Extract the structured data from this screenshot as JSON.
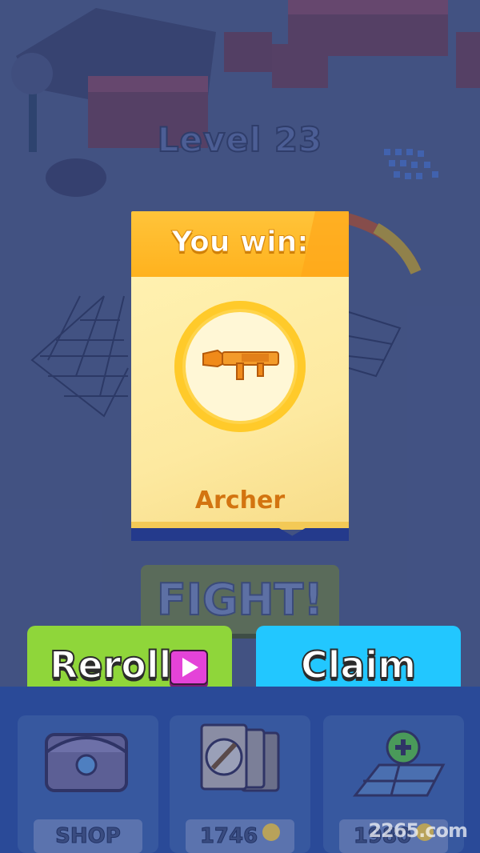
{
  "level_title": "Level 23",
  "reward_card": {
    "header": "You win:",
    "item_name": "Archer",
    "item_icon": "rocket-launcher-icon"
  },
  "fight_button": "FIGHT!",
  "reroll_button": {
    "label": "Reroll",
    "icon": "play-video-icon"
  },
  "claim_button": {
    "label": "Claim"
  },
  "bottom_bar": {
    "shop": {
      "label": "SHOP",
      "icon": "chest-icon"
    },
    "cards": {
      "price": "1746",
      "icon": "sword-cards-icon"
    },
    "expand": {
      "price": "1980",
      "icon": "add-tile-icon"
    }
  },
  "watermark": "2265.com",
  "colors": {
    "card_header": "#ffb21e",
    "reroll": "#8fd63a",
    "claim": "#22c7ff",
    "name_text": "#d37410"
  }
}
